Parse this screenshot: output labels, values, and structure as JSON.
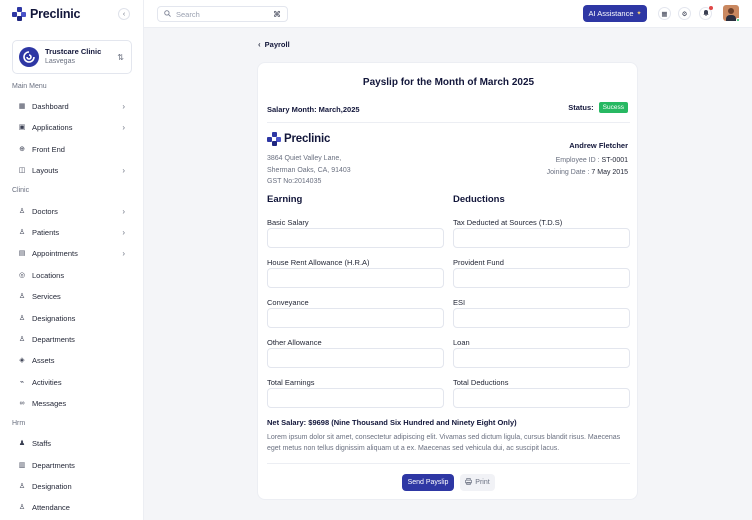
{
  "brand": {
    "name": "Preclinic"
  },
  "clinic": {
    "name": "Trustcare Clinic",
    "location": "Lasvegas"
  },
  "sidebar": {
    "sections": [
      "Main Menu",
      "Clinic",
      "Hrm"
    ],
    "main_items": [
      {
        "label": "Dashboard",
        "icon": "grid-icon"
      },
      {
        "label": "Applications",
        "icon": "apps-icon"
      },
      {
        "label": "Front End",
        "icon": "globe-icon"
      },
      {
        "label": "Layouts",
        "icon": "layout-icon"
      }
    ],
    "clinic_items": [
      {
        "label": "Doctors",
        "icon": "user-icon"
      },
      {
        "label": "Patients",
        "icon": "user-icon"
      },
      {
        "label": "Appointments",
        "icon": "calendar-icon"
      },
      {
        "label": "Locations",
        "icon": "location-icon"
      },
      {
        "label": "Services",
        "icon": "services-icon"
      },
      {
        "label": "Designations",
        "icon": "designations-icon"
      },
      {
        "label": "Departments",
        "icon": "departments-icon"
      },
      {
        "label": "Assets",
        "icon": "assets-icon"
      },
      {
        "label": "Activities",
        "icon": "activity-icon"
      },
      {
        "label": "Messages",
        "icon": "link-icon"
      }
    ],
    "hrm_items": [
      {
        "label": "Staffs",
        "icon": "staff-icon"
      },
      {
        "label": "Departments",
        "icon": "building-icon"
      },
      {
        "label": "Designation",
        "icon": "user-icon"
      },
      {
        "label": "Attendance",
        "icon": "user-icon"
      }
    ]
  },
  "topbar": {
    "search_placeholder": "Search",
    "ai_label": "AI Assistance"
  },
  "page": {
    "back_label": "Payroll",
    "title": "Payslip for the Month of March 2025",
    "salary_month": "Salary Month: March,2025",
    "status_label": "Status:",
    "status_value": "Sucess"
  },
  "company": {
    "address_line1": "3864 Quiet Valley Lane,",
    "address_line2": "Sherman Oaks, CA, 91403",
    "gst": "GST No:2014035"
  },
  "employee": {
    "name": "Andrew Fletcher",
    "id_label": "Employee ID :",
    "id_value": "ST-0001",
    "joining_label": "Joining Date :",
    "joining_value": "7 May 2015"
  },
  "earning": {
    "heading": "Earning",
    "fields": [
      "Basic Salary",
      "House Rent Allowance (H.R.A)",
      "Conveyance",
      "Other Allowance",
      "Total Earnings"
    ]
  },
  "deductions": {
    "heading": "Deductions",
    "fields": [
      "Tax Deducted at Sources (T.D.S)",
      "Provident Fund",
      "ESI",
      "Loan",
      "Total Deductions"
    ]
  },
  "net_salary": "Net Salary: $9698 (Nine Thousand Six Hundred and Ninety Eight Only)",
  "note": "Lorem ipsum dolor sit amet, consectetur adipiscing elit. Vivamas sed dictum ligula, cursus blandit risus. Maecenas eget metus non tellus dignissim aliquam ut a ex. Maecenas sed vehicula dui, ac suscipit lacus.",
  "actions": {
    "send_label": "Send Payslip",
    "print_label": "Print"
  },
  "colors": {
    "primary": "#2e37a4",
    "success": "#27b862"
  }
}
